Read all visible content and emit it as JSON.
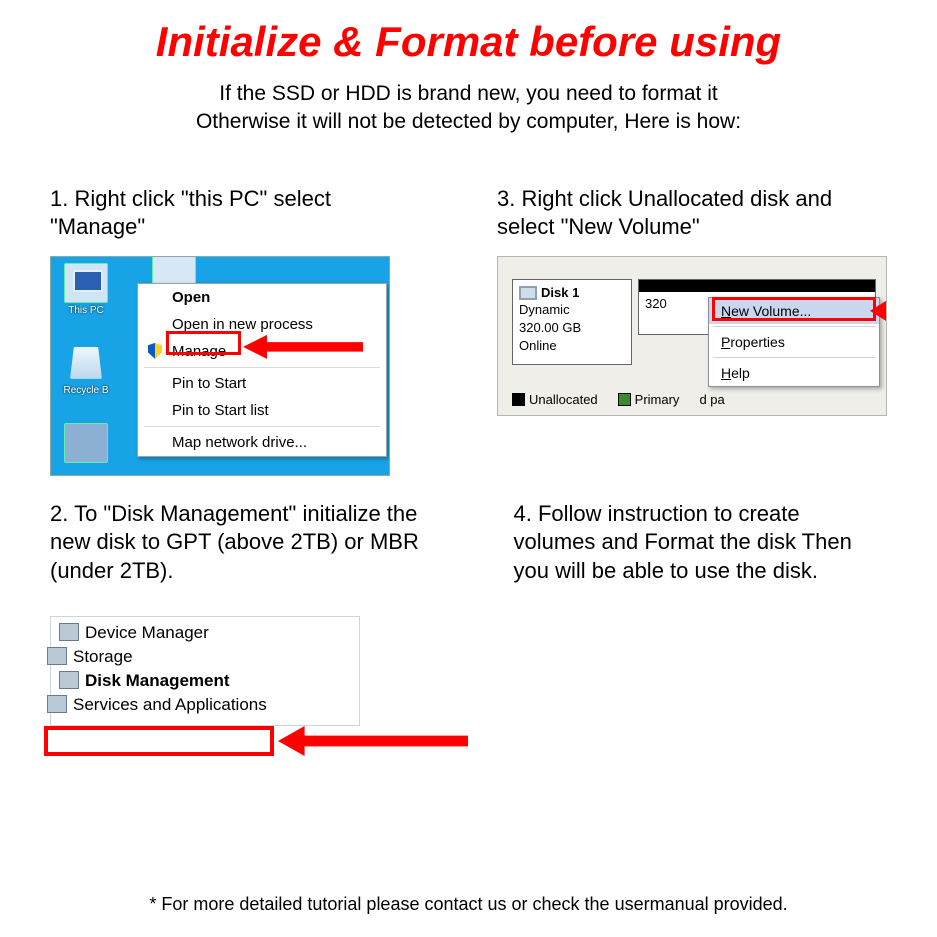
{
  "title": "Initialize & Format before using",
  "subtitle_line1": "If the SSD or HDD is brand new, you need to format it",
  "subtitle_line2": "Otherwise it will not be detected by computer, Here is how:",
  "steps": {
    "s1": "1. Right click \"this PC\" select \"Manage\"",
    "s2": "2. To \"Disk Management\" initialize the new disk to GPT (above 2TB) or MBR (under 2TB).",
    "s3": "3. Right click Unallocated disk and select \"New Volume\"",
    "s4": "4. Follow instruction to create volumes and Format the disk Then you will be able to use the disk."
  },
  "footnote": "* For more detailed tutorial please contact us or check the usermanual provided.",
  "shot1": {
    "desktop_icons": {
      "this_pc": "This PC",
      "recycle": "Recycle B"
    },
    "menu": {
      "open": "Open",
      "open_new": "Open in new process",
      "manage": "Manage",
      "pin_start": "Pin to Start",
      "pin_list": "Pin to Start list",
      "map_drive": "Map network drive..."
    },
    "highlight_target": "Manage"
  },
  "shot3": {
    "disk_label": "Disk 1",
    "disk_type": "Dynamic",
    "disk_size": "320.00 GB",
    "disk_status": "Online",
    "volume_partial": "320",
    "legend_unalloc": "Unallocated",
    "legend_primary": "Primary",
    "legend_tail": "d pa",
    "menu": {
      "new_volume": "New Volume...",
      "properties": "Properties",
      "help": "Help"
    },
    "highlight_target": "New Volume..."
  },
  "mgmt_tree": {
    "device_manager": "Device Manager",
    "storage": "Storage",
    "disk_management": "Disk Management",
    "services": "Services and Applications",
    "highlight_target": "Disk Management"
  },
  "colors": {
    "accent_red": "#ff0000",
    "desktop_blue": "#17a3e5"
  }
}
